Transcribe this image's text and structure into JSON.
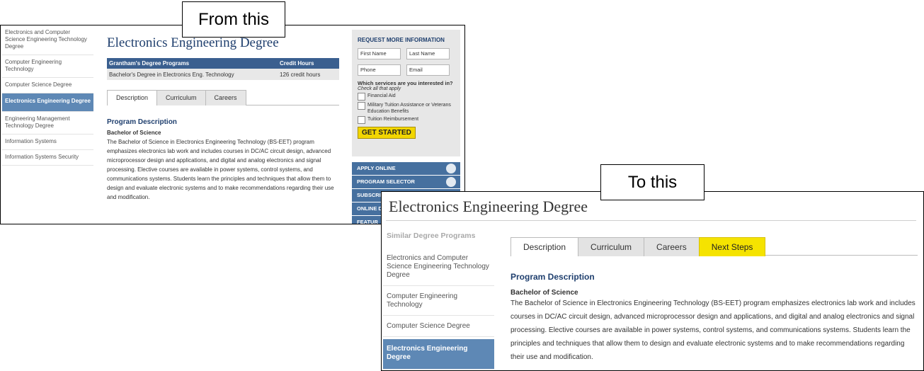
{
  "captions": {
    "from": "From this",
    "to": "To this"
  },
  "before": {
    "sidebar": [
      {
        "label": "Electronics and Computer Science Engineering Technology Degree",
        "active": false
      },
      {
        "label": "Computer Engineering Technology",
        "active": false
      },
      {
        "label": "Computer Science Degree",
        "active": false
      },
      {
        "label": "Electronics Engineering Degree",
        "active": true
      },
      {
        "label": "Engineering Management Technology Degree",
        "active": false
      },
      {
        "label": "Information Systems",
        "active": false
      },
      {
        "label": "Information Systems Security",
        "active": false
      }
    ],
    "title": "Electronics Engineering Degree",
    "table": {
      "headers": [
        "Grantham's Degree Programs",
        "Credit Hours"
      ],
      "rows": [
        [
          "Bachelor's Degree in Electronics Eng. Technology",
          "126 credit hours"
        ]
      ]
    },
    "tabs": [
      "Description",
      "Curriculum",
      "Careers"
    ],
    "program_heading": "Program Description",
    "subheading": "Bachelor of Science",
    "paragraph": "The Bachelor of Science in Electronics Engineering Technology (BS-EET) program emphasizes electronics lab work and includes courses in DC/AC circuit design, advanced microprocessor design and applications, and digital and analog electronics and signal processing.  Elective courses are available in power systems, control systems, and communications systems.  Students learn the principles and techniques that allow them to design and evaluate electronic systems and to make recommendations regarding their use and modification.",
    "form": {
      "title": "REQUEST MORE INFORMATION",
      "first_name": "First Name",
      "last_name": "Last Name",
      "phone": "Phone",
      "email": "Email",
      "question": "Which services are you interested in?",
      "question_sub": "Check all that apply",
      "options": [
        "Financial Aid",
        "Military Tuition Assistance or Veterans Education Benefits",
        "Tuition Reimbursement"
      ],
      "submit": "GET STARTED"
    },
    "nav_buttons": [
      "APPLY ONLINE",
      "PROGRAM SELECTOR",
      "SUBSCRI",
      "ONLINE D",
      "FEATUR"
    ]
  },
  "after": {
    "title": "Electronics Engineering Degree",
    "sidebar_label": "Similar Degree Programs",
    "sidebar": [
      {
        "label": "Electronics and Computer Science Engineering Technology Degree",
        "active": false
      },
      {
        "label": "Computer Engineering Technology",
        "active": false
      },
      {
        "label": "Computer Science Degree",
        "active": false
      },
      {
        "label": "Electronics Engineering Degree",
        "active": true
      }
    ],
    "tabs": [
      "Description",
      "Curriculum",
      "Careers",
      "Next Steps"
    ],
    "program_heading": "Program Description",
    "subheading": "Bachelor of Science",
    "paragraph": "The Bachelor of Science in Electronics Engineering Technology (BS-EET) program emphasizes electronics lab work and includes courses in DC/AC circuit design, advanced microprocessor design and applications, and digital and analog electronics and signal processing.  Elective courses are available in power systems, control systems, and communications systems.  Students learn the principles and techniques that allow them to design and evaluate electronic systems and to make recommendations regarding their use and modification."
  }
}
